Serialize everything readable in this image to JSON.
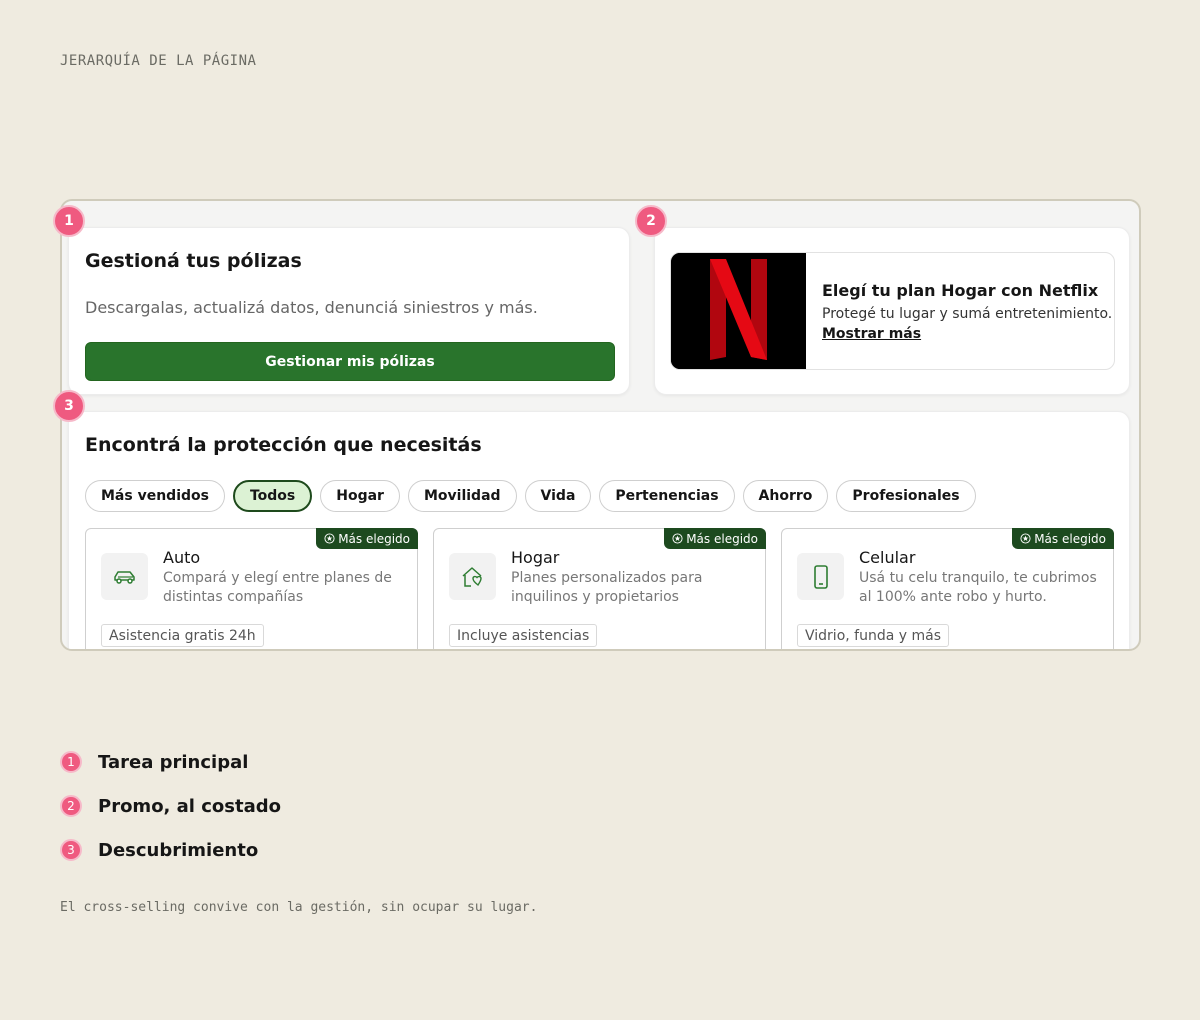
{
  "eyebrow": "JERARQUÍA DE LA PÁGINA",
  "markers": [
    "1",
    "2",
    "3"
  ],
  "manage": {
    "title": "Gestioná tus pólizas",
    "description": "Descargalas, actualizá datos, denunciá siniestros y más.",
    "button": "Gestionar mis pólizas"
  },
  "promo": {
    "logo": "netflix-logo",
    "title": "Elegí tu plan Hogar con Netflix",
    "description": "Protegé tu lugar y sumá entretenimiento.",
    "link": "Mostrar más"
  },
  "discover": {
    "title": "Encontrá la protección que necesitás",
    "chips": [
      "Más vendidos",
      "Todos",
      "Hogar",
      "Movilidad",
      "Vida",
      "Pertenencias",
      "Ahorro",
      "Profesionales"
    ],
    "active_chip": "Todos",
    "products": [
      {
        "badge": "Más elegido",
        "icon": "car-icon",
        "name": "Auto",
        "description": "Compará y elegí entre planes de distintas compañías",
        "tag": "Asistencia gratis 24h"
      },
      {
        "badge": "Más elegido",
        "icon": "home-heart-icon",
        "name": "Hogar",
        "description": "Planes personalizados para inquilinos y propietarios",
        "tag": "Incluye asistencias"
      },
      {
        "badge": "Más elegido",
        "icon": "phone-icon",
        "name": "Celular",
        "description": "Usá tu celu tranquilo, te cubrimos al 100% ante robo y hurto.",
        "tag": "Vidrio, funda y más"
      }
    ]
  },
  "legend": [
    {
      "number": "1",
      "label": "Tarea principal"
    },
    {
      "number": "2",
      "label": "Promo, al costado"
    },
    {
      "number": "3",
      "label": "Descubrimiento"
    }
  ],
  "footnote": "El cross-selling convive con la gestión, sin ocupar su lugar.",
  "colors": {
    "background": "#efebe0",
    "primary_green": "#29742c",
    "badge_green": "#1d4a1f",
    "active_chip_bg": "#dcf2d4",
    "marker_pink": "#ef5a80"
  }
}
